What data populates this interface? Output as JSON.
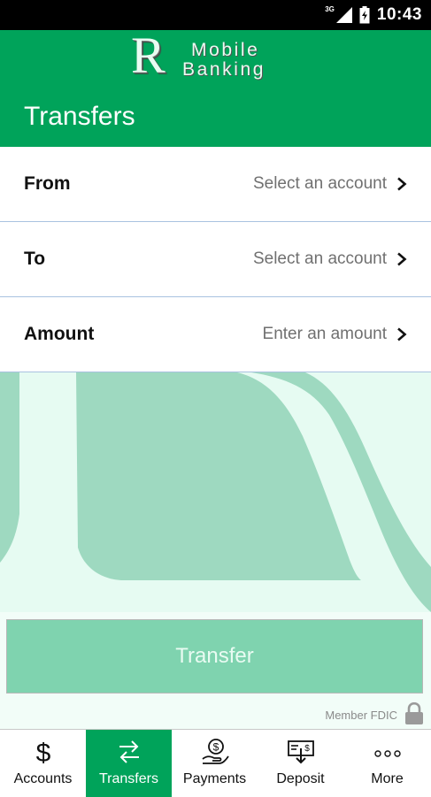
{
  "status_bar": {
    "network": "3G",
    "time": "10:43"
  },
  "header": {
    "logo_letter": "R",
    "logo_line1": "Mobile",
    "logo_line2": "Banking",
    "title": "Transfers"
  },
  "form": {
    "rows": [
      {
        "label": "From",
        "value": "Select an account"
      },
      {
        "label": "To",
        "value": "Select an account"
      },
      {
        "label": "Amount",
        "value": "Enter an amount"
      }
    ]
  },
  "transfer_button_label": "Transfer",
  "footer_note": "Member FDIC",
  "bottom_nav": {
    "active": "Transfers",
    "items": [
      {
        "label": "Accounts",
        "icon": "dollar-icon"
      },
      {
        "label": "Transfers",
        "icon": "transfer-arrows-icon"
      },
      {
        "label": "Payments",
        "icon": "hand-coin-icon"
      },
      {
        "label": "Deposit",
        "icon": "check-deposit-icon"
      },
      {
        "label": "More",
        "icon": "more-dots-icon"
      }
    ]
  },
  "colors": {
    "brand_green": "#00a35a",
    "banner_background": "#e6fbf2",
    "banner_shape": "#9ed9c0",
    "button_fill": "#7fd3af",
    "divider": "#a9c2e0"
  }
}
